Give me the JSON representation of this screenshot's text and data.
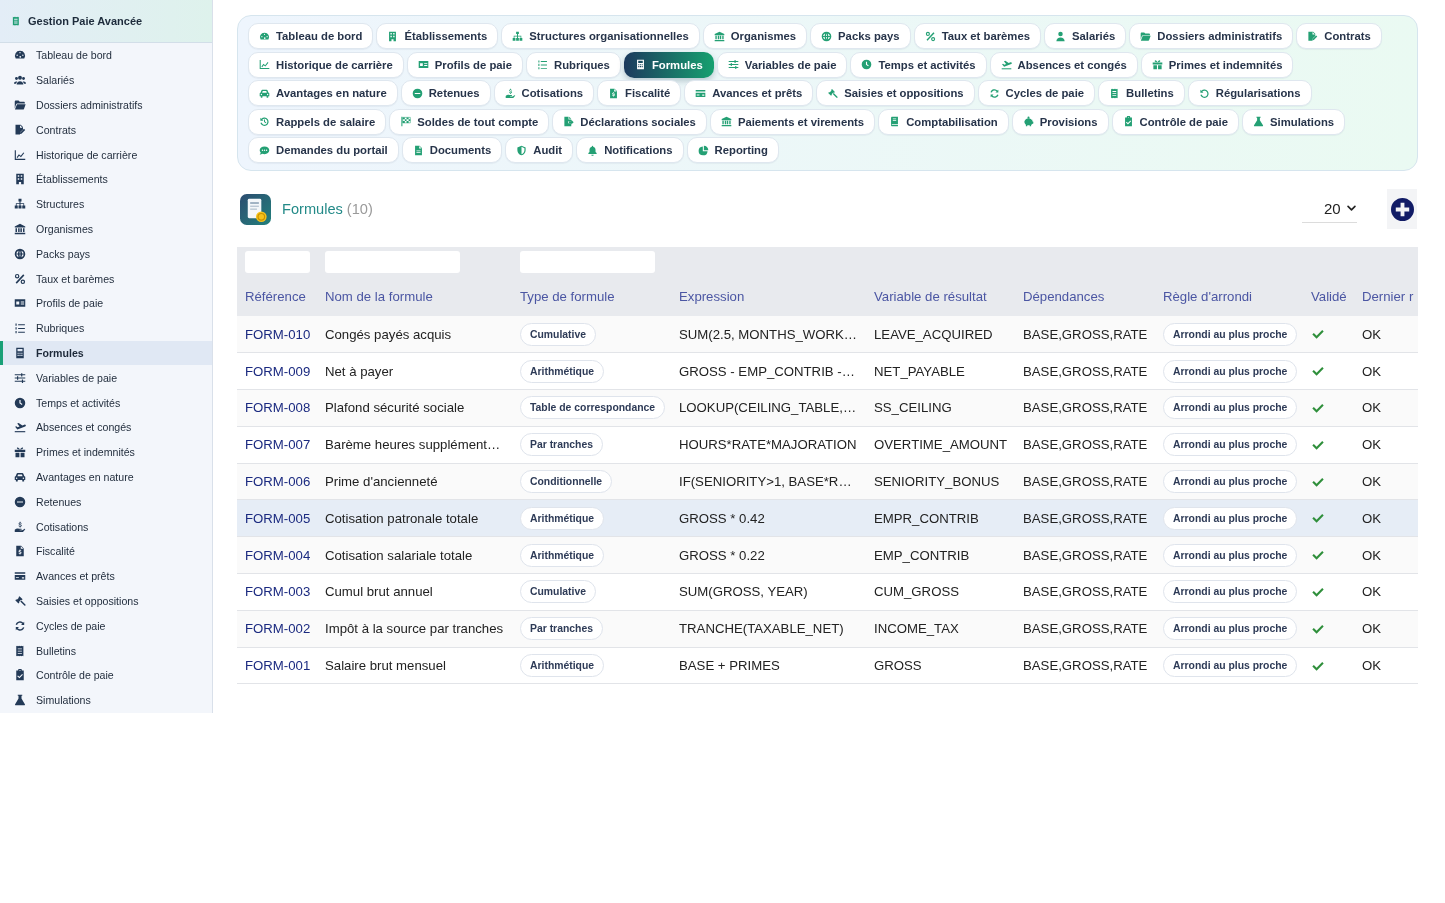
{
  "sidebar": {
    "title": "Gestion Paie Avancée",
    "items": [
      {
        "label": "Tableau de bord",
        "selected": false
      },
      {
        "label": "Salariés",
        "selected": false
      },
      {
        "label": "Dossiers administratifs",
        "selected": false
      },
      {
        "label": "Contrats",
        "selected": false
      },
      {
        "label": "Historique de carrière",
        "selected": false
      },
      {
        "label": "Établissements",
        "selected": false
      },
      {
        "label": "Structures",
        "selected": false
      },
      {
        "label": "Organismes",
        "selected": false
      },
      {
        "label": "Packs pays",
        "selected": false
      },
      {
        "label": "Taux et barèmes",
        "selected": false
      },
      {
        "label": "Profils de paie",
        "selected": false
      },
      {
        "label": "Rubriques",
        "selected": false
      },
      {
        "label": "Formules",
        "selected": true
      },
      {
        "label": "Variables de paie",
        "selected": false
      },
      {
        "label": "Temps et activités",
        "selected": false
      },
      {
        "label": "Absences et congés",
        "selected": false
      },
      {
        "label": "Primes et indemnités",
        "selected": false
      },
      {
        "label": "Avantages en nature",
        "selected": false
      },
      {
        "label": "Retenues",
        "selected": false
      },
      {
        "label": "Cotisations",
        "selected": false
      },
      {
        "label": "Fiscalité",
        "selected": false
      },
      {
        "label": "Avances et prêts",
        "selected": false
      },
      {
        "label": "Saisies et oppositions",
        "selected": false
      },
      {
        "label": "Cycles de paie",
        "selected": false
      },
      {
        "label": "Bulletins",
        "selected": false
      },
      {
        "label": "Contrôle de paie",
        "selected": false
      },
      {
        "label": "Simulations",
        "selected": false
      }
    ]
  },
  "tabs": [
    {
      "label": "Tableau de bord",
      "selected": false
    },
    {
      "label": "Établissements",
      "selected": false
    },
    {
      "label": "Structures organisationnelles",
      "selected": false
    },
    {
      "label": "Organismes",
      "selected": false
    },
    {
      "label": "Packs pays",
      "selected": false
    },
    {
      "label": "Taux et barèmes",
      "selected": false
    },
    {
      "label": "Salariés",
      "selected": false
    },
    {
      "label": "Dossiers administratifs",
      "selected": false
    },
    {
      "label": "Contrats",
      "selected": false
    },
    {
      "label": "Historique de carrière",
      "selected": false
    },
    {
      "label": "Profils de paie",
      "selected": false
    },
    {
      "label": "Rubriques",
      "selected": false
    },
    {
      "label": "Formules",
      "selected": true
    },
    {
      "label": "Variables de paie",
      "selected": false
    },
    {
      "label": "Temps et activités",
      "selected": false
    },
    {
      "label": "Absences et congés",
      "selected": false
    },
    {
      "label": "Primes et indemnités",
      "selected": false
    },
    {
      "label": "Avantages en nature",
      "selected": false
    },
    {
      "label": "Retenues",
      "selected": false
    },
    {
      "label": "Cotisations",
      "selected": false
    },
    {
      "label": "Fiscalité",
      "selected": false
    },
    {
      "label": "Avances et prêts",
      "selected": false
    },
    {
      "label": "Saisies et oppositions",
      "selected": false
    },
    {
      "label": "Cycles de paie",
      "selected": false
    },
    {
      "label": "Bulletins",
      "selected": false
    },
    {
      "label": "Régularisations",
      "selected": false
    },
    {
      "label": "Rappels de salaire",
      "selected": false
    },
    {
      "label": "Soldes de tout compte",
      "selected": false
    },
    {
      "label": "Déclarations sociales",
      "selected": false
    },
    {
      "label": "Paiements et virements",
      "selected": false
    },
    {
      "label": "Comptabilisation",
      "selected": false
    },
    {
      "label": "Provisions",
      "selected": false
    },
    {
      "label": "Contrôle de paie",
      "selected": false
    },
    {
      "label": "Simulations",
      "selected": false
    },
    {
      "label": "Demandes du portail",
      "selected": false
    },
    {
      "label": "Documents",
      "selected": false
    },
    {
      "label": "Audit",
      "selected": false
    },
    {
      "label": "Notifications",
      "selected": false
    },
    {
      "label": "Reporting",
      "selected": false
    }
  ],
  "page": {
    "title": "Formules",
    "count": "(10)",
    "page_size": "20"
  },
  "table": {
    "columns": [
      {
        "label": "Référence",
        "filterable": true
      },
      {
        "label": "Nom de la formule",
        "filterable": true
      },
      {
        "label": "Type de formule",
        "filterable": true
      },
      {
        "label": "Expression",
        "filterable": false
      },
      {
        "label": "Variable de résultat",
        "filterable": false
      },
      {
        "label": "Dépendances",
        "filterable": false
      },
      {
        "label": "Règle d'arrondi",
        "filterable": false
      },
      {
        "label": "Validé",
        "filterable": false
      },
      {
        "label": "Dernier r",
        "filterable": false
      }
    ],
    "rows": [
      {
        "reference": "FORM-010",
        "name": "Congés payés acquis",
        "type": "Cumulative",
        "expression": "SUM(2.5, MONTHS_WORK…",
        "result_variable": "LEAVE_ACQUIRED",
        "dependencies": "BASE,GROSS,RATE",
        "rounding": "Arrondi au plus proche",
        "validated": true,
        "last_result": "OK",
        "selected": false
      },
      {
        "reference": "FORM-009",
        "name": "Net à payer",
        "type": "Arithmétique",
        "expression": "GROSS - EMP_CONTRIB -…",
        "result_variable": "NET_PAYABLE",
        "dependencies": "BASE,GROSS,RATE",
        "rounding": "Arrondi au plus proche",
        "validated": true,
        "last_result": "OK",
        "selected": false
      },
      {
        "reference": "FORM-008",
        "name": "Plafond sécurité sociale",
        "type": "Table de correspondance",
        "expression": "LOOKUP(CEILING_TABLE,…",
        "result_variable": "SS_CEILING",
        "dependencies": "BASE,GROSS,RATE",
        "rounding": "Arrondi au plus proche",
        "validated": true,
        "last_result": "OK",
        "selected": false
      },
      {
        "reference": "FORM-007",
        "name": "Barème heures supplément…",
        "type": "Par tranches",
        "expression": "HOURS*RATE*MAJORATION",
        "result_variable": "OVERTIME_AMOUNT",
        "dependencies": "BASE,GROSS,RATE",
        "rounding": "Arrondi au plus proche",
        "validated": true,
        "last_result": "OK",
        "selected": false
      },
      {
        "reference": "FORM-006",
        "name": "Prime d'ancienneté",
        "type": "Conditionnelle",
        "expression": "IF(SENIORITY>1, BASE*R…",
        "result_variable": "SENIORITY_BONUS",
        "dependencies": "BASE,GROSS,RATE",
        "rounding": "Arrondi au plus proche",
        "validated": true,
        "last_result": "OK",
        "selected": false
      },
      {
        "reference": "FORM-005",
        "name": "Cotisation patronale totale",
        "type": "Arithmétique",
        "expression": "GROSS * 0.42",
        "result_variable": "EMPR_CONTRIB",
        "dependencies": "BASE,GROSS,RATE",
        "rounding": "Arrondi au plus proche",
        "validated": true,
        "last_result": "OK",
        "selected": true
      },
      {
        "reference": "FORM-004",
        "name": "Cotisation salariale totale",
        "type": "Arithmétique",
        "expression": "GROSS * 0.22",
        "result_variable": "EMP_CONTRIB",
        "dependencies": "BASE,GROSS,RATE",
        "rounding": "Arrondi au plus proche",
        "validated": true,
        "last_result": "OK",
        "selected": false
      },
      {
        "reference": "FORM-003",
        "name": "Cumul brut annuel",
        "type": "Cumulative",
        "expression": "SUM(GROSS, YEAR)",
        "result_variable": "CUM_GROSS",
        "dependencies": "BASE,GROSS,RATE",
        "rounding": "Arrondi au plus proche",
        "validated": true,
        "last_result": "OK",
        "selected": false
      },
      {
        "reference": "FORM-002",
        "name": "Impôt à la source par tranches",
        "type": "Par tranches",
        "expression": "TRANCHE(TAXABLE_NET)",
        "result_variable": "INCOME_TAX",
        "dependencies": "BASE,GROSS,RATE",
        "rounding": "Arrondi au plus proche",
        "validated": true,
        "last_result": "OK",
        "selected": false
      },
      {
        "reference": "FORM-001",
        "name": "Salaire brut mensuel",
        "type": "Arithmétique",
        "expression": "BASE + PRIMES",
        "result_variable": "GROSS",
        "dependencies": "BASE,GROSS,RATE",
        "rounding": "Arrondi au plus proche",
        "validated": true,
        "last_result": "OK",
        "selected": false
      }
    ]
  }
}
